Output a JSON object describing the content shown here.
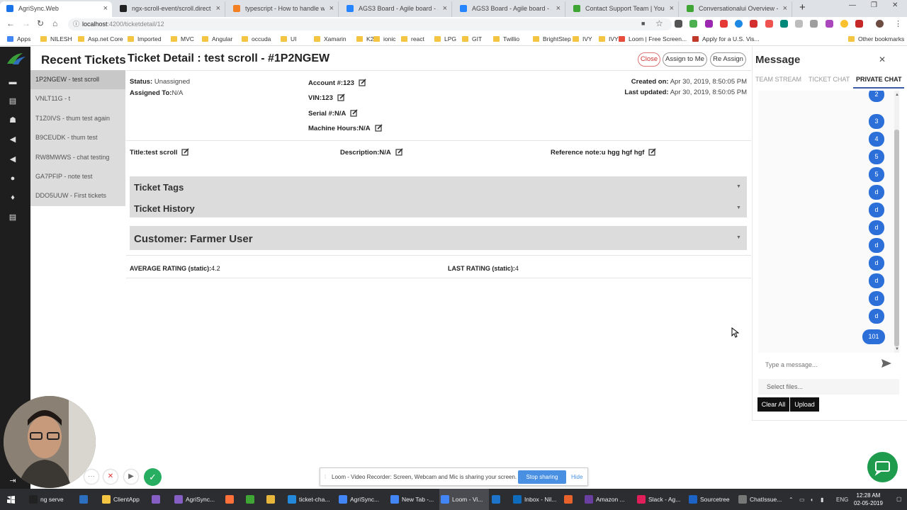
{
  "browser": {
    "tabs": [
      {
        "title": "AgriSync.Web",
        "active": true,
        "color": "#1a73e8"
      },
      {
        "title": "ngx-scroll-event/scroll.directive.t",
        "color": "#222222"
      },
      {
        "title": "typescript - How to handle wind",
        "color": "#f48024"
      },
      {
        "title": "AGS3 Board - Agile board - Jira",
        "color": "#2684ff"
      },
      {
        "title": "AGS3 Board - Agile board - Jira",
        "color": "#2684ff"
      },
      {
        "title": "Contact Support Team | Your Ac",
        "color": "#3fa535"
      },
      {
        "title": "Conversationalui Overview - Con",
        "color": "#3fa535"
      }
    ],
    "url_host": "localhost",
    "url_path": ":4200/ticketdetail/12",
    "bookmarks": [
      "Apps",
      "NILESH",
      "Asp.net Core",
      "Imported",
      "MVC",
      "Angular",
      "occuda",
      "UI",
      "Xamarin",
      "K2",
      "ionic",
      "react",
      "LPG",
      "GIT",
      "Twillio",
      "BrightStep",
      "IVY",
      "IVY",
      "Loom | Free Screen...",
      "Apply for a U.S. Vis...",
      "Other bookmarks"
    ]
  },
  "recent": {
    "title": "Recent Tickets",
    "items": [
      "1P2NGEW - test scroll",
      "VNLT11G - t",
      "T1Z0IVS - thum test again",
      "B9CEUDK - thum test",
      "RW8MWWS - chat testing",
      "GA7PFIP - note test",
      "DDO5UUW - First tickets"
    ]
  },
  "ticket": {
    "title": "Ticket Detail : test scroll - #1P2NGEW",
    "buttons": {
      "close": "Close",
      "assign": "Assign to Me",
      "reassign": "Re Assign"
    },
    "status_label": "Status:",
    "status_value": "Unassigned",
    "assigned_label": "Assigned To:",
    "assigned_value": "N/A",
    "account": "Account #:123",
    "vin": "VIN:123",
    "serial": "Serial #:N/A",
    "machine_hours": "Machine Hours:N/A",
    "created_label": "Created on:",
    "created_value": "Apr 30, 2019, 8:50:05 PM",
    "updated_label": "Last updated:",
    "updated_value": "Apr 30, 2019, 8:50:05 PM",
    "title_field": "Title:test scroll",
    "description": "Description:N/A",
    "reference": "Reference note:u hgg hgf hgf",
    "sections": {
      "tags": "Ticket Tags",
      "history": "Ticket History",
      "customer": "Customer: Farmer User"
    },
    "avg_rating_label": "AVERAGE RATING (static):",
    "avg_rating_value": "4.2",
    "last_rating_label": "LAST RATING (static):",
    "last_rating_value": "4"
  },
  "message": {
    "title": "Message",
    "tabs": [
      "TEAM STREAM",
      "TICKET CHAT",
      "PRIVATE CHAT"
    ],
    "active_tab": "PRIVATE CHAT",
    "bubbles": [
      "2",
      "3",
      "4",
      "5",
      "5",
      "d",
      "d",
      "d",
      "d",
      "d",
      "d",
      "d",
      "d",
      "101"
    ],
    "placeholder": "Type a message...",
    "select_files": "Select files...",
    "clear_all": "Clear All",
    "upload": "Upload",
    "accent": "#2c6fd8"
  },
  "loom": {
    "message": "Loom - Video Recorder: Screen, Webcam and Mic is sharing your screen.",
    "stop": "Stop sharing",
    "hide": "Hide"
  },
  "taskbar": {
    "items": [
      {
        "label": "ng serve",
        "color": "#222222"
      },
      {
        "label": "",
        "color": "#2d6fbf"
      },
      {
        "label": "ClientApp",
        "color": "#f4c542"
      },
      {
        "label": "",
        "color": "#865fc5"
      },
      {
        "label": "AgriSync...",
        "color": "#865fc5"
      },
      {
        "label": "",
        "color": "#ff7139"
      },
      {
        "label": "",
        "color": "#3fa535"
      },
      {
        "label": "",
        "color": "#e8b63b"
      },
      {
        "label": "ticket-cha...",
        "color": "#2489d8"
      },
      {
        "label": "AgriSync...",
        "color": "#4285f4"
      },
      {
        "label": "New Tab -...",
        "color": "#4285f4"
      },
      {
        "label": "Loom - Vi...",
        "color": "#4285f4"
      },
      {
        "label": "",
        "color": "#1e74c9"
      },
      {
        "label": "Inbox - Nil...",
        "color": "#0f6cbd"
      },
      {
        "label": "",
        "color": "#e8632b"
      },
      {
        "label": "Amazon ...",
        "color": "#6a3fa0"
      },
      {
        "label": "Slack - Ag...",
        "color": "#e01e5a"
      },
      {
        "label": "Sourcetree",
        "color": "#1c63c5"
      },
      {
        "label": "ChatIssue...",
        "color": "#777777"
      }
    ],
    "lang": "ENG",
    "time": "12:28 AM",
    "date": "02-05-2019"
  }
}
